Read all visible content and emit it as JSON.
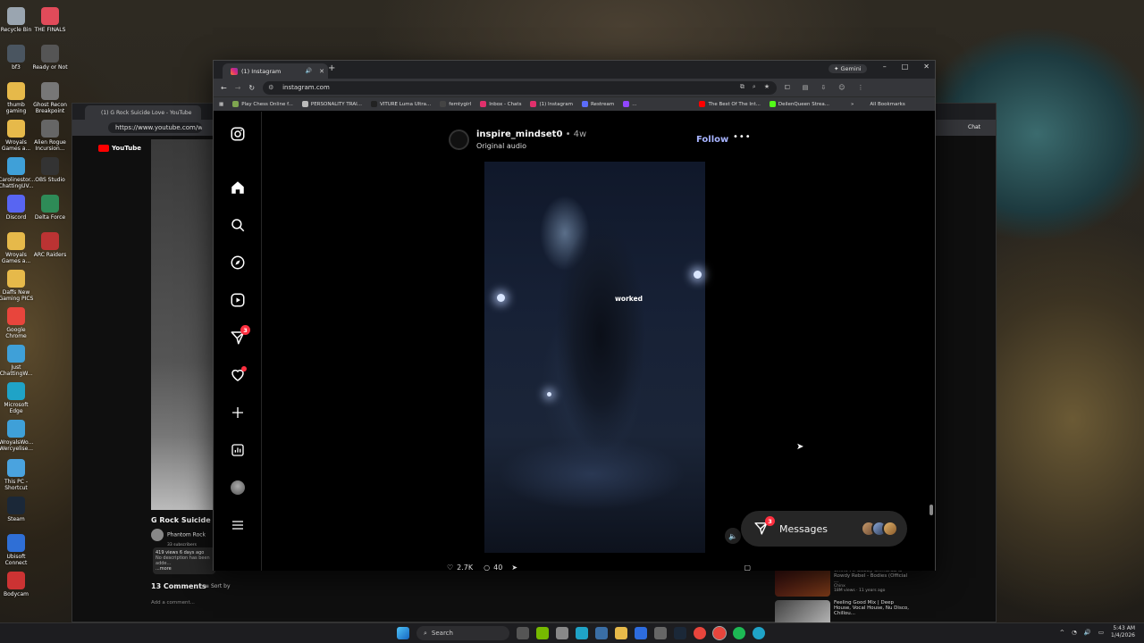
{
  "desktop": {
    "icons": [
      {
        "label": "Recycle Bin",
        "color": "#9aa5b0"
      },
      {
        "label": "THE FINALS",
        "color": "#e14b5a"
      },
      {
        "label": "bf3",
        "color": "#4a5560"
      },
      {
        "label": "Ready or Not",
        "color": "#555"
      },
      {
        "label": "thumb gaming",
        "color": "#e6b94a"
      },
      {
        "label": "Ghost Recon Breakpoint",
        "color": "#777"
      },
      {
        "label": "Wroyals Games a...",
        "color": "#e6b94a"
      },
      {
        "label": "Alien Rogue Incursion...",
        "color": "#666"
      },
      {
        "label": "Carolinestor... ChattingUV...",
        "color": "#3fa0d8"
      },
      {
        "label": "OBS Studio",
        "color": "#333"
      },
      {
        "label": "Discord",
        "color": "#5865f2"
      },
      {
        "label": "Delta Force",
        "color": "#2e8b57"
      },
      {
        "label": "Wroyals Games a...",
        "color": "#e6b94a"
      },
      {
        "label": "ARC Raiders",
        "color": "#b33"
      },
      {
        "label": "Daffs New Gaming PICS",
        "color": "#e6b94a"
      },
      {
        "label": "Google Chrome",
        "color": "#e8453c"
      },
      {
        "label": "Just ChattingW...",
        "color": "#3fa0d8"
      },
      {
        "label": "Microsoft Edge",
        "color": "#1fa3c7"
      },
      {
        "label": "WroyalsWo... Wercyelise...",
        "color": "#3fa0d8"
      },
      {
        "label": "This PC - Shortcut",
        "color": "#4aa3df"
      },
      {
        "label": "Steam",
        "color": "#1b2838"
      },
      {
        "label": "Ubisoft Connect",
        "color": "#2f6fd6"
      },
      {
        "label": "Bodycam",
        "color": "#c33"
      }
    ]
  },
  "youtube_window": {
    "tab_title": "(1) G Rock Suicide Love - YouTube",
    "url": "https://www.youtube.com/watch?",
    "logo": "YouTube",
    "video_title": "G Rock Suicide Love",
    "channel": "Phantom Rock",
    "subscribers": "33 subscribers",
    "views": "419 views  6 days ago",
    "description": "No description has been adde...",
    "more": "...more",
    "comments_count": "13 Comments",
    "sort_by": "Sort by",
    "add_comment": "Add a comment...",
    "chat_button": "Chat",
    "sidebar": [
      {
        "title": "Chinx Ft. Bobby Shmurda & Rowdy Rebel - Bodies (Official ...",
        "channel": "Chinx",
        "meta": "18M views · 11 years ago",
        "duration": "4:50"
      },
      {
        "title": "Feeling Good Mix | Deep House, Vocal House, Nu Disco, Chillou...",
        "channel": "",
        "meta": "",
        "duration": ""
      }
    ]
  },
  "browser": {
    "tab": {
      "title": "(1) Instagram"
    },
    "gemini_label": "Gemini",
    "url": "instagram.com",
    "bookmarks": [
      {
        "label": "Play Chess Online f...",
        "color": "#7fa650"
      },
      {
        "label": "PERSONALITY TRAI...",
        "color": "#bbb"
      },
      {
        "label": "VITURE Luma Ultra...",
        "color": "#222"
      },
      {
        "label": "femtygirl",
        "color": "#444"
      },
      {
        "label": "Inbox - Chats",
        "color": "#e1306c"
      },
      {
        "label": "(1) Instagram",
        "color": "#e1306c"
      },
      {
        "label": "Restream",
        "color": "#5b6cf9"
      },
      {
        "label": "...",
        "color": "#9146ff"
      },
      {
        "label": "The Best Of The Int...",
        "color": "#f00"
      },
      {
        "label": "DeilenQueen Strea...",
        "color": "#53fc18"
      }
    ],
    "all_bookmarks": "All Bookmarks"
  },
  "instagram": {
    "nav_badge_count": "3",
    "post": {
      "username": "inspire_mindset0",
      "age": " • 4w",
      "audio": "Original audio",
      "follow_label": "Follow",
      "caption_overlay": "worked",
      "likes": "2.7K",
      "comments": "40"
    },
    "messages": {
      "label": "Messages",
      "badge": "3"
    }
  },
  "taskbar": {
    "search_placeholder": "Search",
    "time": "5:43 AM",
    "date": "1/4/2026"
  }
}
